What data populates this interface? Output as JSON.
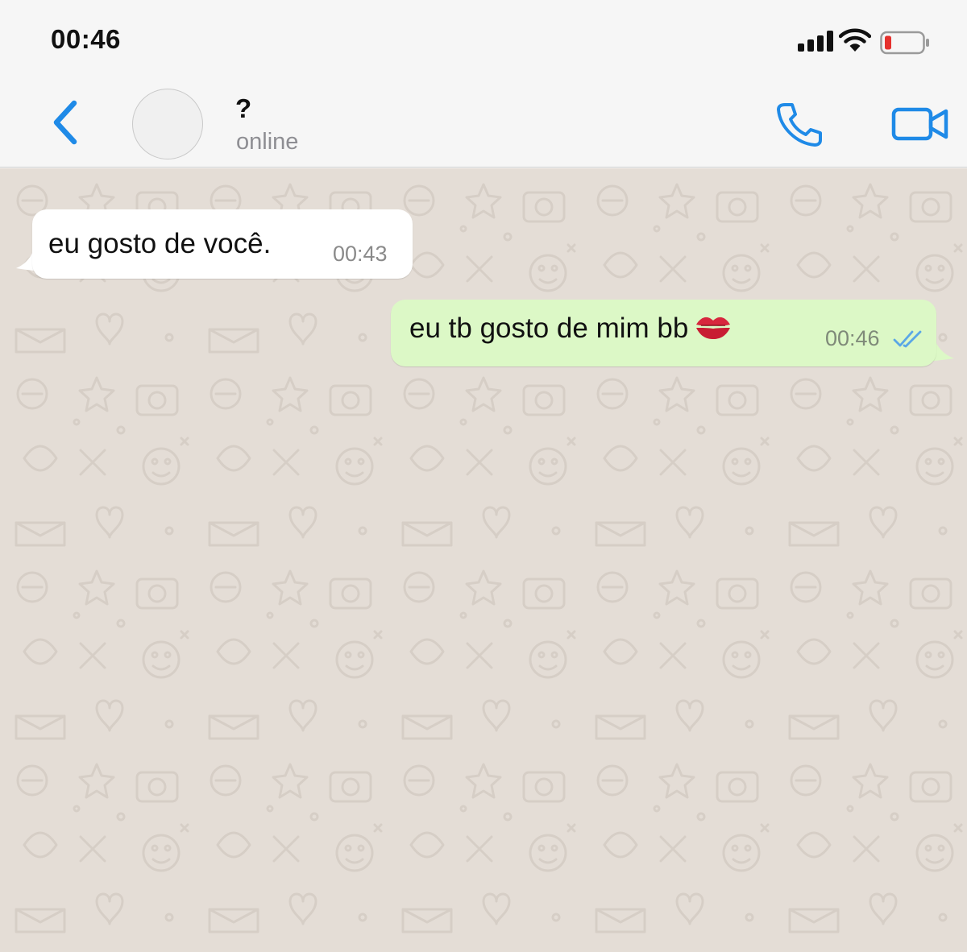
{
  "status_bar": {
    "time": "00:46",
    "icons": [
      "signal-icon",
      "wifi-icon",
      "battery-low-icon"
    ]
  },
  "header": {
    "contact_name": "?",
    "contact_status": "online",
    "icons": [
      "back-chevron-icon",
      "phone-icon",
      "video-camera-icon"
    ]
  },
  "messages": [
    {
      "direction": "incoming",
      "text": "eu gosto de você.",
      "time": "00:43"
    },
    {
      "direction": "outgoing",
      "text": "eu tb gosto de mim bb",
      "emoji": "kiss-mark-icon",
      "time": "00:46",
      "status": "read",
      "status_icon": "double-check-icon"
    }
  ],
  "colors": {
    "accent": "#1f8ae7",
    "incoming_bubble": "#ffffff",
    "outgoing_bubble": "#dcf8c6",
    "chat_background": "#e4ddd6",
    "read_ticks": "#5aa7e6",
    "battery_low": "#e5312d"
  }
}
